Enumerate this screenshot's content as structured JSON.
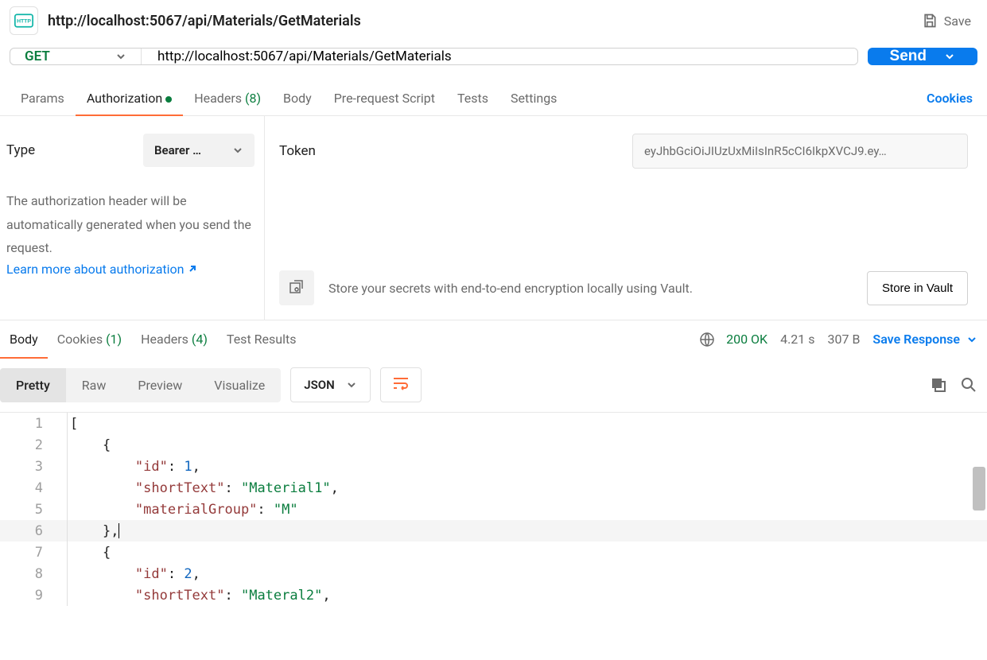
{
  "header": {
    "title": "http://localhost:5067/api/Materials/GetMaterials",
    "save_label": "Save"
  },
  "request": {
    "method": "GET",
    "url": "http://localhost:5067/api/Materials/GetMaterials",
    "send_label": "Send"
  },
  "req_tabs": {
    "params": "Params",
    "authorization": "Authorization",
    "headers": "Headers",
    "headers_count": "(8)",
    "body": "Body",
    "prerequest": "Pre-request Script",
    "tests": "Tests",
    "settings": "Settings",
    "cookies": "Cookies"
  },
  "auth": {
    "type_label": "Type",
    "type_value": "Bearer …",
    "description": "The authorization header will be automatically generated when you send the request.",
    "learn_more": "Learn more about authorization",
    "token_label": "Token",
    "token_value": "eyJhbGciOiJIUzUxMiIsInR5cCI6IkpXVCJ9.ey…",
    "vault_text": "Store your secrets with end-to-end encryption locally using Vault.",
    "vault_btn": "Store in Vault"
  },
  "response": {
    "tabs": {
      "body": "Body",
      "cookies": "Cookies",
      "cookies_count": "(1)",
      "headers": "Headers",
      "headers_count": "(4)",
      "test_results": "Test Results"
    },
    "status": {
      "code": "200",
      "text": "OK"
    },
    "time": "4.21 s",
    "size": "307 B",
    "save_response": "Save Response",
    "view_tabs": {
      "pretty": "Pretty",
      "raw": "Raw",
      "preview": "Preview",
      "visualize": "Visualize"
    },
    "format": "JSON",
    "code_lines": [
      {
        "n": 1,
        "tokens": [
          {
            "t": "punc",
            "v": "["
          }
        ]
      },
      {
        "n": 2,
        "tokens": [
          {
            "t": "indent",
            "v": "    "
          },
          {
            "t": "punc",
            "v": "{"
          }
        ]
      },
      {
        "n": 3,
        "tokens": [
          {
            "t": "indent",
            "v": "        "
          },
          {
            "t": "key",
            "v": "\"id\""
          },
          {
            "t": "punc",
            "v": ": "
          },
          {
            "t": "num",
            "v": "1"
          },
          {
            "t": "punc",
            "v": ","
          }
        ]
      },
      {
        "n": 4,
        "tokens": [
          {
            "t": "indent",
            "v": "        "
          },
          {
            "t": "key",
            "v": "\"shortText\""
          },
          {
            "t": "punc",
            "v": ": "
          },
          {
            "t": "str",
            "v": "\"Material1\""
          },
          {
            "t": "punc",
            "v": ","
          }
        ]
      },
      {
        "n": 5,
        "tokens": [
          {
            "t": "indent",
            "v": "        "
          },
          {
            "t": "key",
            "v": "\"materialGroup\""
          },
          {
            "t": "punc",
            "v": ": "
          },
          {
            "t": "str",
            "v": "\"M\""
          }
        ]
      },
      {
        "n": 6,
        "tokens": [
          {
            "t": "indent",
            "v": "    "
          },
          {
            "t": "punc",
            "v": "},"
          }
        ],
        "hl": true,
        "caret": true
      },
      {
        "n": 7,
        "tokens": [
          {
            "t": "indent",
            "v": "    "
          },
          {
            "t": "punc",
            "v": "{"
          }
        ]
      },
      {
        "n": 8,
        "tokens": [
          {
            "t": "indent",
            "v": "        "
          },
          {
            "t": "key",
            "v": "\"id\""
          },
          {
            "t": "punc",
            "v": ": "
          },
          {
            "t": "num",
            "v": "2"
          },
          {
            "t": "punc",
            "v": ","
          }
        ]
      },
      {
        "n": 9,
        "tokens": [
          {
            "t": "indent",
            "v": "        "
          },
          {
            "t": "key",
            "v": "\"shortText\""
          },
          {
            "t": "punc",
            "v": ": "
          },
          {
            "t": "str",
            "v": "\"Materal2\""
          },
          {
            "t": "punc",
            "v": ","
          }
        ]
      }
    ]
  }
}
